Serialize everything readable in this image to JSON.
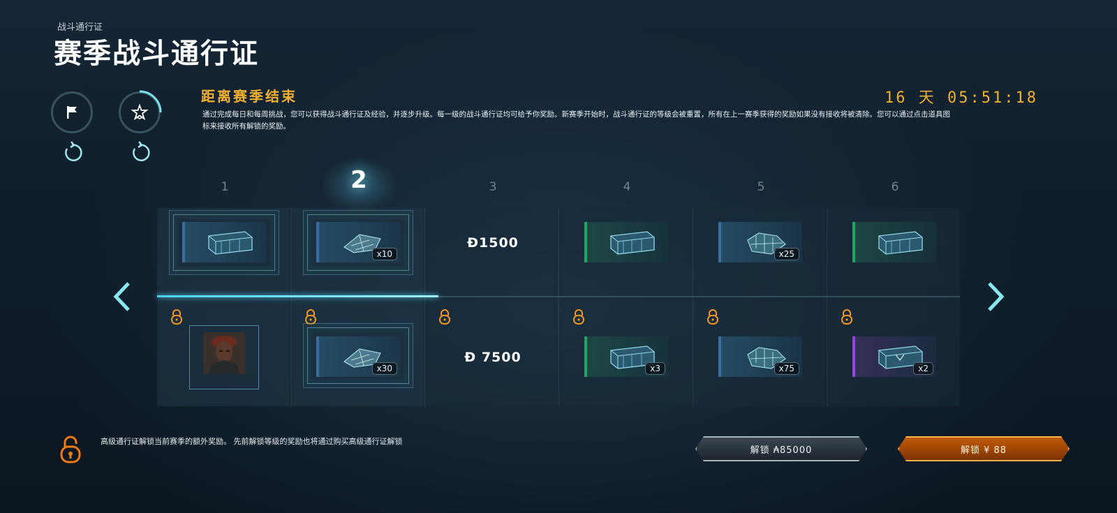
{
  "header": {
    "breadcrumb": "战斗通行证",
    "title": "赛季战斗通行证"
  },
  "side_buttons": [
    {
      "name": "flag-button",
      "icon": "flag-icon"
    },
    {
      "name": "star-rank-button",
      "icon": "star-icon"
    }
  ],
  "season": {
    "heading": "距离赛季结束",
    "countdown": "16 天 05:51:18",
    "description": "通过完成每日和每周挑战，您可以获得战斗通行证及经验，并逐步升级。每一级的战斗通行证均可给予你奖励。新赛季开始时，战斗通行证的等级会被重置，所有在上一赛季获得的奖励如果没有接收将被清除。您可以通过点击道具图标来接收所有解锁的奖励。"
  },
  "track": {
    "current_level": 2,
    "progress_fraction": 0.35,
    "levels": [
      "1",
      "2",
      "3",
      "4",
      "5",
      "6"
    ],
    "free_rewards": [
      {
        "icon": "crate-icon",
        "rarity": "blue",
        "qty": ""
      },
      {
        "icon": "blueprint-icon",
        "rarity": "blue",
        "qty": "x10"
      },
      {
        "icon": "coin-icon",
        "amount": "Đ1500"
      },
      {
        "icon": "crate-icon",
        "rarity": "green",
        "qty": ""
      },
      {
        "icon": "ship-parts-icon",
        "rarity": "blue",
        "qty": "x25"
      },
      {
        "icon": "crate-icon",
        "rarity": "green",
        "qty": ""
      }
    ],
    "premium_rewards": [
      {
        "icon": "commander-portrait",
        "qty": ""
      },
      {
        "icon": "blueprint-icon",
        "rarity": "blue",
        "qty": "x30"
      },
      {
        "icon": "coin-icon",
        "amount": "Đ 7500"
      },
      {
        "icon": "crate-icon",
        "rarity": "green",
        "qty": "x3"
      },
      {
        "icon": "ship-parts-icon",
        "rarity": "blue",
        "qty": "x75"
      },
      {
        "icon": "crate-icon",
        "rarity": "purple",
        "qty": "x2"
      }
    ]
  },
  "footer": {
    "premium_note": "高级通行证解锁当前赛季的额外奖励。 先前解锁等级的奖励也将通过购买高级通行证解锁",
    "unlock_currency_label": "解锁 ₳85000",
    "unlock_cash_label": "解锁 ¥ 88"
  },
  "colors": {
    "accent_gold": "#f2b02c",
    "accent_cyan": "#49d4ee",
    "rarity_blue": "#3a6fa6",
    "rarity_green": "#2aa160",
    "rarity_purple": "#9448d8"
  }
}
